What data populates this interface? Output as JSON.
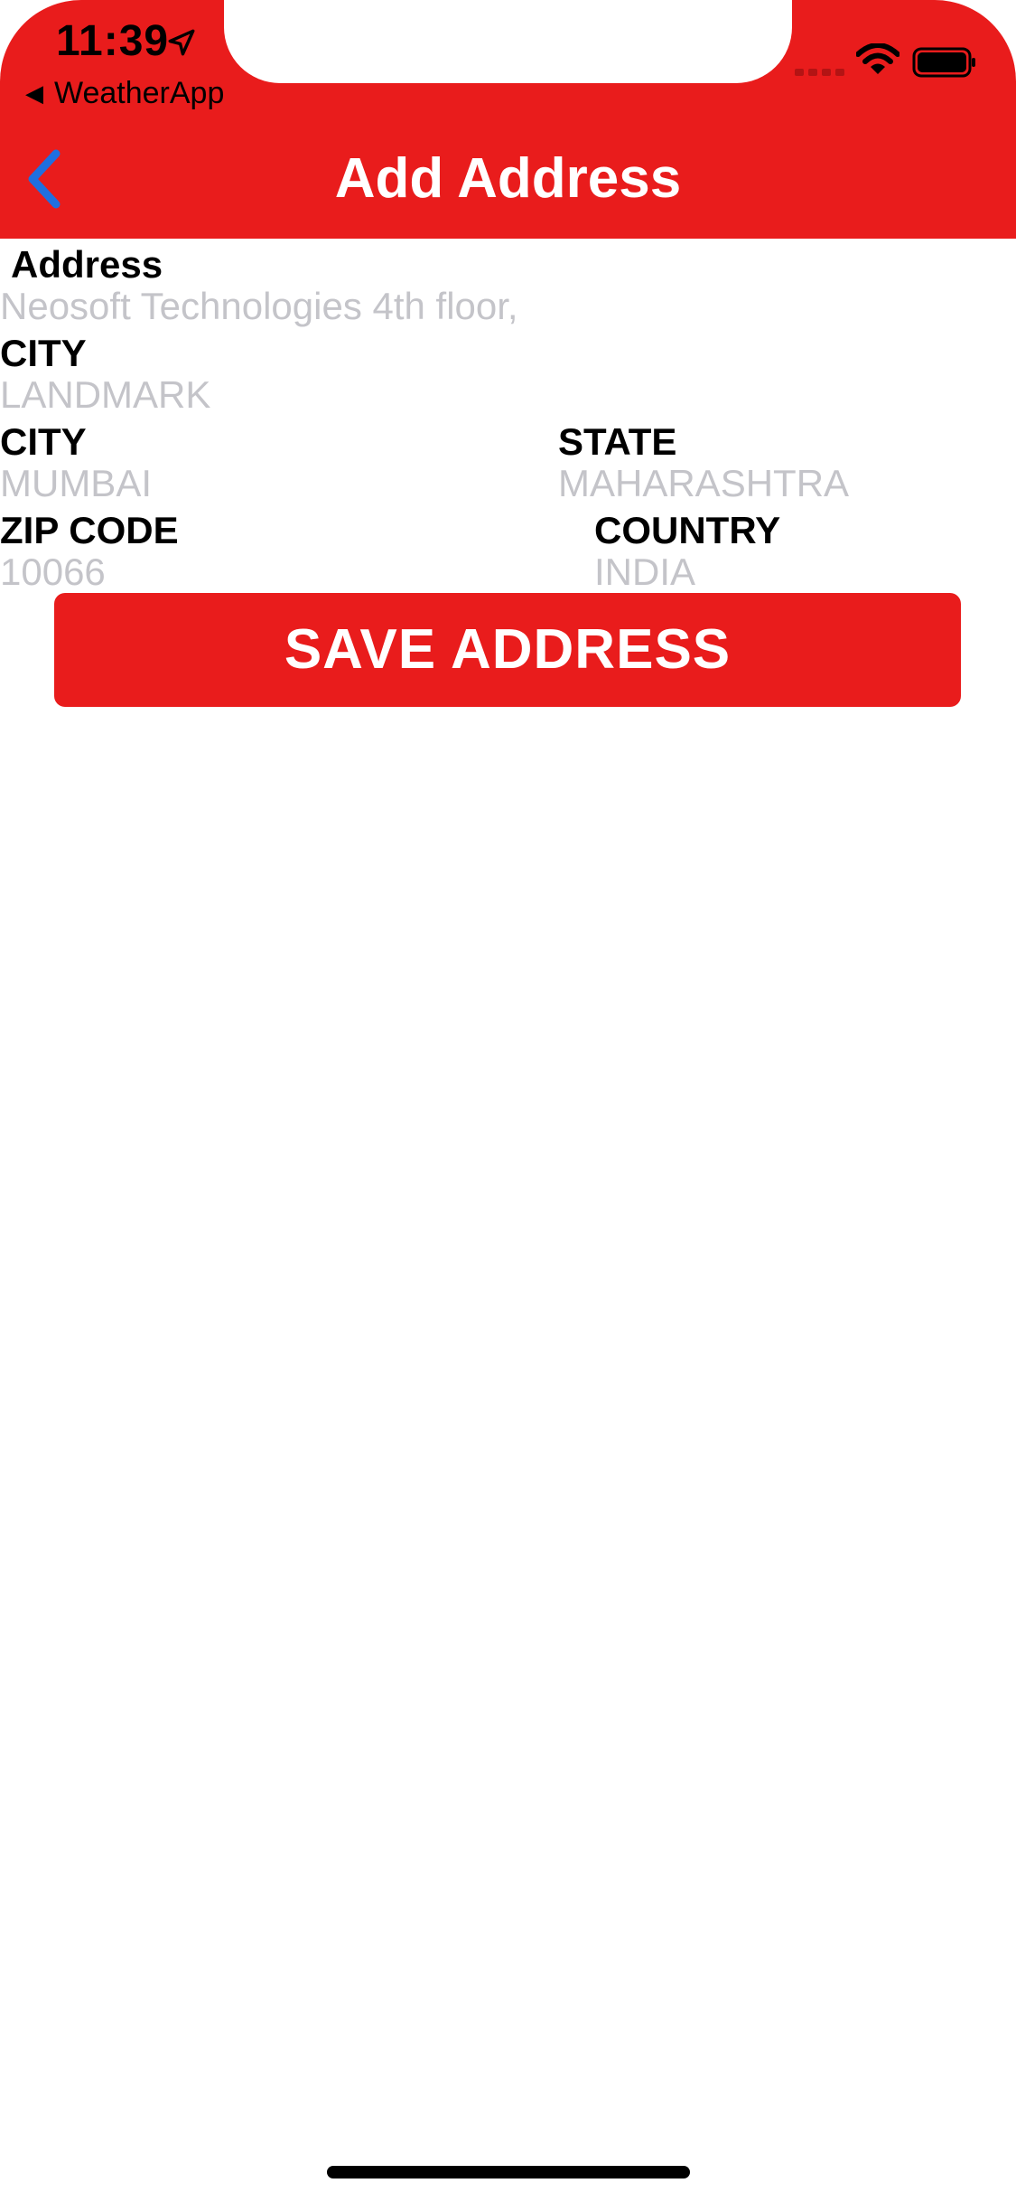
{
  "status_bar": {
    "time": "11:39",
    "back_app_label": "WeatherApp",
    "icons": [
      "location-arrow-icon",
      "signal-icon",
      "wifi-icon",
      "battery-icon"
    ]
  },
  "nav": {
    "title": "Add Address",
    "back_icon": "chevron-left-icon"
  },
  "form": {
    "address": {
      "label": "Address",
      "value": "Neosoft Technologies 4th floor,"
    },
    "landmark": {
      "label": "CITY",
      "placeholder": "LANDMARK"
    },
    "city": {
      "label": "CITY",
      "placeholder": "MUMBAI"
    },
    "state": {
      "label": "STATE",
      "placeholder": "MAHARASHTRA"
    },
    "zip": {
      "label": "ZIP CODE",
      "placeholder": "10066"
    },
    "country": {
      "label": "COUNTRY",
      "placeholder": "INDIA"
    }
  },
  "actions": {
    "save_label": "SAVE ADDRESS"
  },
  "colors": {
    "brand_red": "#e91c1c",
    "back_chevron_blue": "#1f6fe0",
    "placeholder_gray": "#c4c4c9"
  }
}
